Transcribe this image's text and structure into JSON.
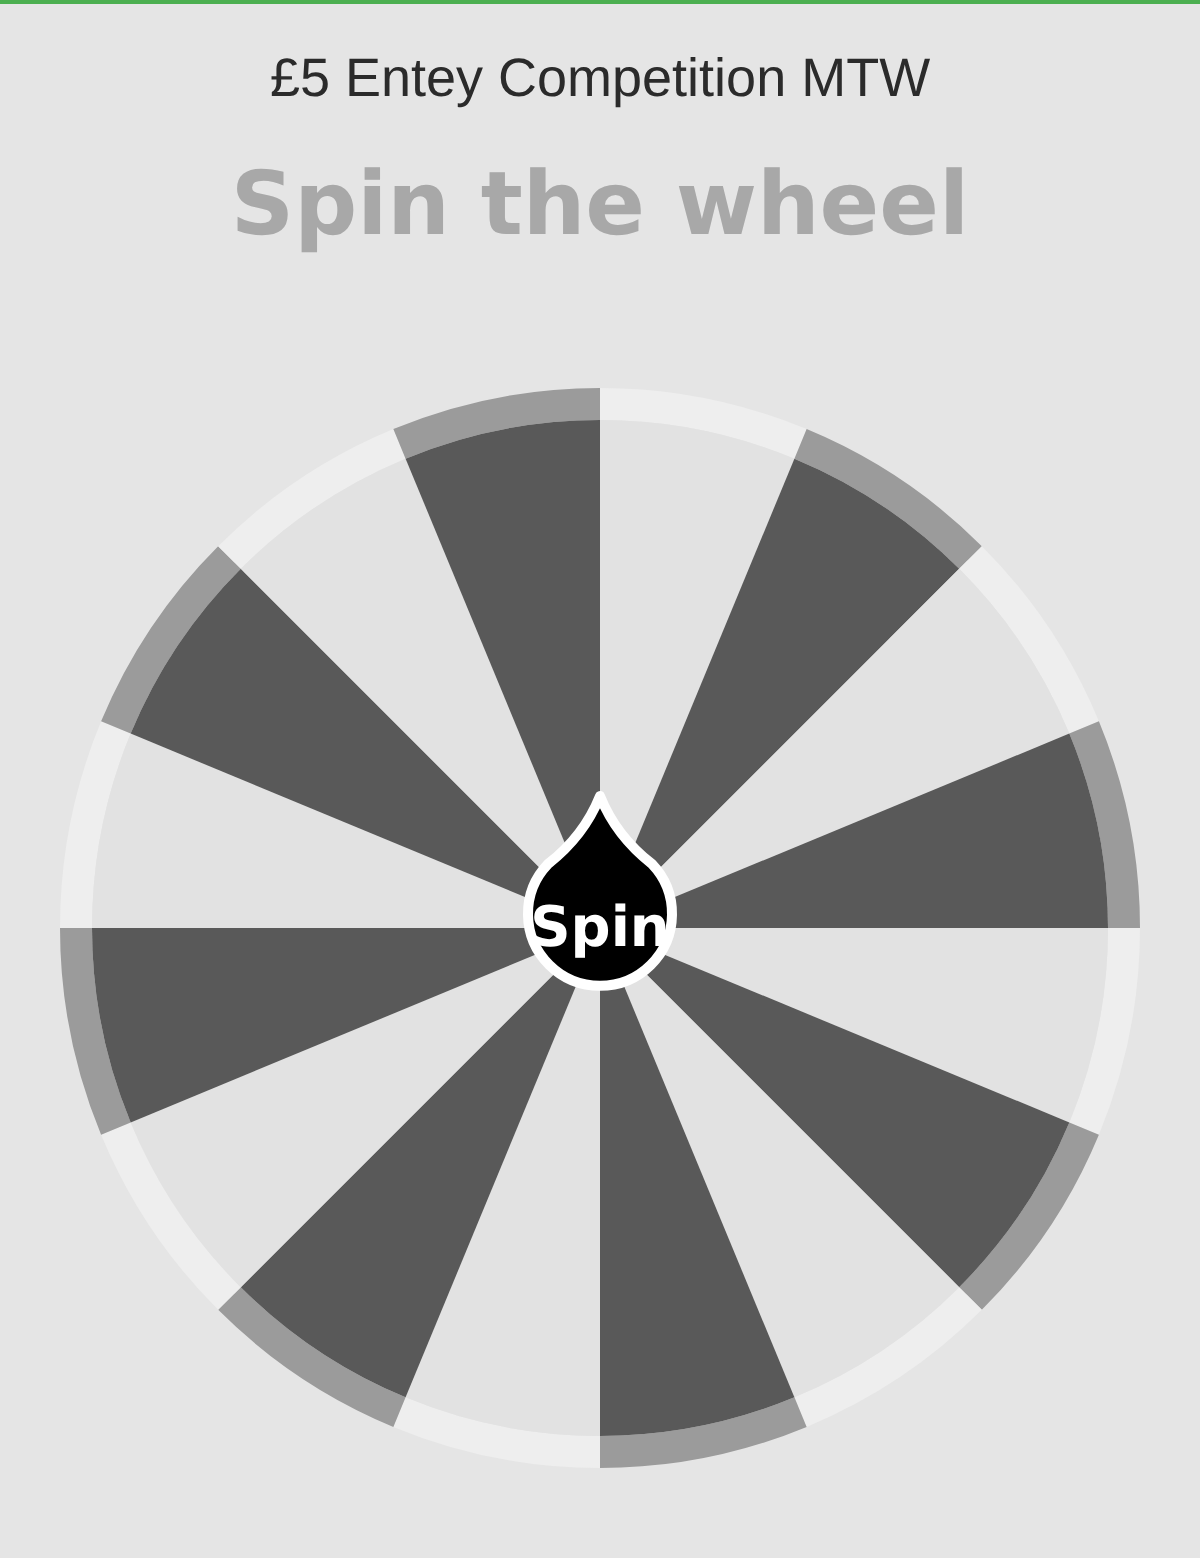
{
  "title": "£5 Entey Competition MTW",
  "heading": "Spin the wheel",
  "wheel": {
    "segments": [
      {
        "color": "#e2e2e2"
      },
      {
        "color": "#595959"
      },
      {
        "color": "#e2e2e2"
      },
      {
        "color": "#595959"
      },
      {
        "color": "#e2e2e2"
      },
      {
        "color": "#595959"
      },
      {
        "color": "#e2e2e2"
      },
      {
        "color": "#595959"
      },
      {
        "color": "#e2e2e2"
      },
      {
        "color": "#595959"
      },
      {
        "color": "#e2e2e2"
      },
      {
        "color": "#595959"
      },
      {
        "color": "#e2e2e2"
      },
      {
        "color": "#595959"
      },
      {
        "color": "#e2e2e2"
      },
      {
        "color": "#595959"
      }
    ],
    "button": "Spin"
  }
}
